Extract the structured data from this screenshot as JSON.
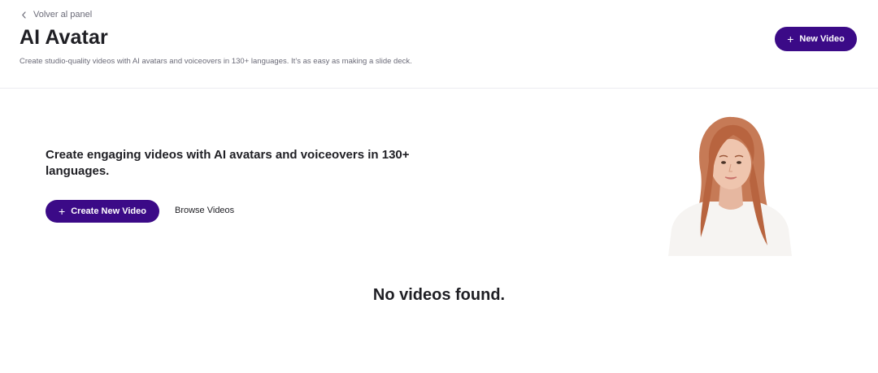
{
  "header": {
    "back_label": "Volver al panel",
    "title": "AI Avatar",
    "subtitle": "Create studio-quality videos with AI avatars and voiceovers in 130+ languages. It’s as easy as making a slide deck.",
    "new_video_label": "New Video"
  },
  "hero": {
    "heading": "Create engaging videos with AI avatars and voiceovers in 130+ languages.",
    "create_button_label": "Create New Video",
    "browse_label": "Browse Videos",
    "avatar_icon": "avatar-portrait"
  },
  "empty_state": {
    "message": "No videos found."
  },
  "colors": {
    "primary": "#3b0a87",
    "text": "#1f1f24",
    "muted": "#6b6b78",
    "divider": "#ececf0"
  }
}
